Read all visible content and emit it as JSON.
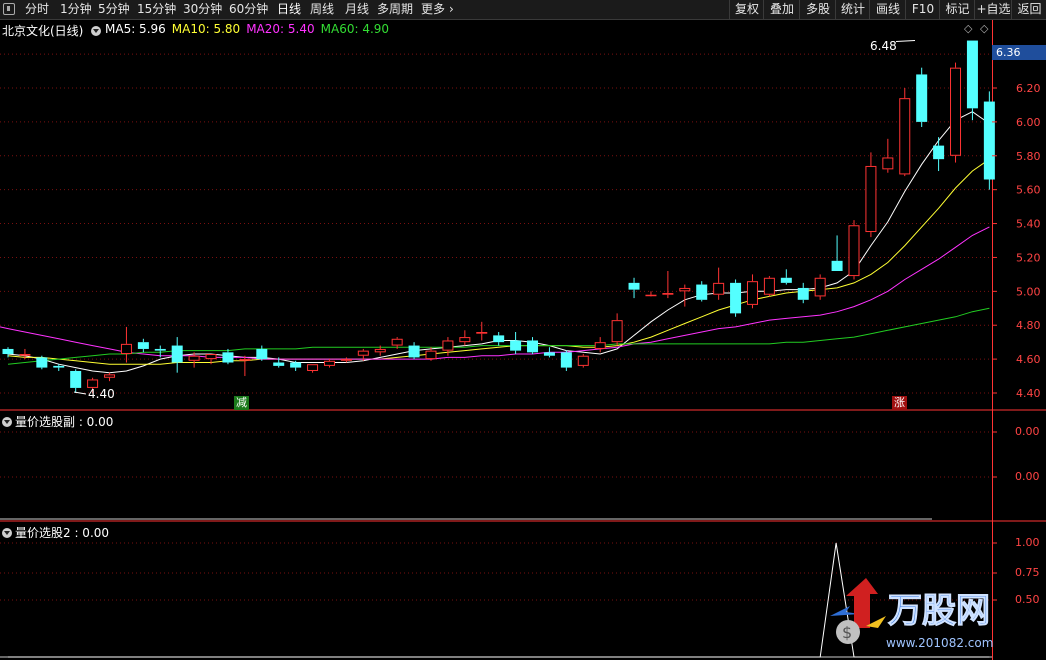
{
  "toolbar": {
    "periods": [
      "分时",
      "1分钟",
      "5分钟",
      "15分钟",
      "30分钟",
      "60分钟",
      "日线",
      "周线",
      "月线",
      "多周期",
      "更多"
    ],
    "active_period": "日线",
    "right_buttons": [
      "复权",
      "叠加",
      "多股",
      "统计",
      "画线",
      "F10",
      "标记",
      "+自选",
      "返回"
    ]
  },
  "main_panel": {
    "title": "北京文化(日线)",
    "ma_labels": [
      {
        "text": "MA5: 5.96",
        "color": "#ffffff"
      },
      {
        "text": "MA10: 5.80",
        "color": "#ffff33"
      },
      {
        "text": "MA20: 5.40",
        "color": "#ff33ff"
      },
      {
        "text": "MA60: 4.90",
        "color": "#33dd33"
      }
    ],
    "current_price": "6.36",
    "high_label": "6.48",
    "low_label": "4.40",
    "signal_reduce": "减",
    "signal_rise": "涨",
    "y_ticks": [
      {
        "label": "6.20",
        "value": 6.2
      },
      {
        "label": "6.00",
        "value": 6.0
      },
      {
        "label": "5.80",
        "value": 5.8
      },
      {
        "label": "5.60",
        "value": 5.6
      },
      {
        "label": "5.40",
        "value": 5.4
      },
      {
        "label": "5.20",
        "value": 5.2
      },
      {
        "label": "5.00",
        "value": 5.0
      },
      {
        "label": "4.80",
        "value": 4.8
      },
      {
        "label": "4.60",
        "value": 4.6
      },
      {
        "label": "4.40",
        "value": 4.4
      }
    ]
  },
  "sub_panel_1": {
    "title": "量价选股副 : 0.00",
    "y_ticks": [
      "0.00",
      "0.00"
    ]
  },
  "sub_panel_2": {
    "title": "量价选股2 : 0.00",
    "y_ticks": [
      "1.00",
      "0.75",
      "0.50"
    ]
  },
  "watermark": {
    "brand": "万股网",
    "site": "www.201082.com"
  },
  "colors": {
    "up": "#ff3333",
    "down": "#54ffff",
    "grid": "#7a1010",
    "axis": "#ff3333"
  },
  "chart_data": {
    "type": "candlestick",
    "candles": [
      [
        4.66,
        4.67,
        4.61,
        4.63
      ],
      [
        4.62,
        4.66,
        4.6,
        4.63
      ],
      [
        4.61,
        4.62,
        4.54,
        4.55
      ],
      [
        4.56,
        4.57,
        4.53,
        4.55
      ],
      [
        4.53,
        4.54,
        4.4,
        4.43
      ],
      [
        4.43,
        4.49,
        4.4,
        4.48
      ],
      [
        4.49,
        4.52,
        4.47,
        4.51
      ],
      [
        4.63,
        4.79,
        4.58,
        4.69
      ],
      [
        4.7,
        4.72,
        4.64,
        4.66
      ],
      [
        4.66,
        4.68,
        4.61,
        4.65
      ],
      [
        4.68,
        4.73,
        4.52,
        4.58
      ],
      [
        4.59,
        4.64,
        4.55,
        4.62
      ],
      [
        4.6,
        4.63,
        4.57,
        4.63
      ],
      [
        4.64,
        4.66,
        4.57,
        4.58
      ],
      [
        4.59,
        4.62,
        4.5,
        4.6
      ],
      [
        4.66,
        4.68,
        4.59,
        4.6
      ],
      [
        4.58,
        4.61,
        4.55,
        4.56
      ],
      [
        4.58,
        4.59,
        4.53,
        4.55
      ],
      [
        4.53,
        4.57,
        4.52,
        4.57
      ],
      [
        4.56,
        4.6,
        4.55,
        4.59
      ],
      [
        4.59,
        4.61,
        4.58,
        4.6
      ],
      [
        4.62,
        4.66,
        4.59,
        4.65
      ],
      [
        4.64,
        4.68,
        4.62,
        4.66
      ],
      [
        4.68,
        4.73,
        4.66,
        4.72
      ],
      [
        4.68,
        4.7,
        4.6,
        4.61
      ],
      [
        4.6,
        4.67,
        4.59,
        4.65
      ],
      [
        4.65,
        4.73,
        4.62,
        4.71
      ],
      [
        4.7,
        4.77,
        4.68,
        4.73
      ],
      [
        4.75,
        4.82,
        4.71,
        4.76
      ],
      [
        4.74,
        4.76,
        4.68,
        4.7
      ],
      [
        4.71,
        4.76,
        4.63,
        4.65
      ],
      [
        4.71,
        4.73,
        4.63,
        4.64
      ],
      [
        4.64,
        4.67,
        4.61,
        4.62
      ],
      [
        4.64,
        4.65,
        4.53,
        4.55
      ],
      [
        4.56,
        4.63,
        4.55,
        4.62
      ],
      [
        4.66,
        4.73,
        4.64,
        4.7
      ],
      [
        4.7,
        4.87,
        4.68,
        4.83
      ],
      [
        5.05,
        5.08,
        4.96,
        5.01
      ],
      [
        4.98,
        5.0,
        4.97,
        4.98
      ],
      [
        4.98,
        5.12,
        4.96,
        4.99
      ],
      [
        5.0,
        5.04,
        4.91,
        5.02
      ],
      [
        5.04,
        5.06,
        4.94,
        4.95
      ],
      [
        4.98,
        5.14,
        4.95,
        5.05
      ],
      [
        5.05,
        5.07,
        4.85,
        4.87
      ],
      [
        4.92,
        5.1,
        4.9,
        5.06
      ],
      [
        4.98,
        5.09,
        4.97,
        5.08
      ],
      [
        5.08,
        5.13,
        5.04,
        5.05
      ],
      [
        5.02,
        5.05,
        4.93,
        4.95
      ],
      [
        4.97,
        5.1,
        4.95,
        5.08
      ],
      [
        5.18,
        5.33,
        5.14,
        5.12
      ],
      [
        5.09,
        5.42,
        5.07,
        5.39
      ],
      [
        5.35,
        5.82,
        5.32,
        5.74
      ],
      [
        5.72,
        5.9,
        5.7,
        5.79
      ],
      [
        5.69,
        6.2,
        5.68,
        6.14
      ],
      [
        6.28,
        6.32,
        5.97,
        6.0
      ],
      [
        5.86,
        5.91,
        5.71,
        5.78
      ],
      [
        5.8,
        6.35,
        5.76,
        6.32
      ],
      [
        6.48,
        6.48,
        6.01,
        6.08
      ],
      [
        6.12,
        6.18,
        5.6,
        5.66
      ]
    ],
    "ma_series": [
      {
        "name": "MA5",
        "values": [
          4.63,
          4.62,
          4.6,
          4.57,
          4.55,
          4.53,
          4.52,
          4.53,
          4.56,
          4.6,
          4.62,
          4.63,
          4.63,
          4.62,
          4.61,
          4.61,
          4.6,
          4.58,
          4.58,
          4.58,
          4.58,
          4.59,
          4.61,
          4.63,
          4.65,
          4.66,
          4.67,
          4.68,
          4.69,
          4.71,
          4.71,
          4.7,
          4.68,
          4.65,
          4.64,
          4.63,
          4.66,
          4.74,
          4.82,
          4.89,
          4.95,
          4.98,
          4.99,
          4.99,
          5.0,
          5.0,
          5.01,
          5.01,
          5.02,
          5.05,
          5.12,
          5.27,
          5.41,
          5.59,
          5.75,
          5.89,
          6.01,
          6.06,
          5.99
        ]
      },
      {
        "name": "MA10",
        "values": [
          4.62,
          4.61,
          4.61,
          4.6,
          4.59,
          4.58,
          4.57,
          4.57,
          4.57,
          4.57,
          4.58,
          4.58,
          4.58,
          4.59,
          4.59,
          4.6,
          4.6,
          4.6,
          4.6,
          4.6,
          4.6,
          4.6,
          4.6,
          4.61,
          4.62,
          4.63,
          4.64,
          4.65,
          4.66,
          4.67,
          4.68,
          4.68,
          4.68,
          4.68,
          4.67,
          4.67,
          4.68,
          4.7,
          4.73,
          4.77,
          4.81,
          4.85,
          4.89,
          4.92,
          4.95,
          4.97,
          4.99,
          5.0,
          5.01,
          5.02,
          5.05,
          5.1,
          5.17,
          5.27,
          5.38,
          5.49,
          5.61,
          5.71,
          5.78
        ]
      },
      {
        "name": "MA20",
        "values": [
          4.78,
          4.76,
          4.74,
          4.72,
          4.7,
          4.68,
          4.66,
          4.64,
          4.63,
          4.62,
          4.62,
          4.62,
          4.61,
          4.61,
          4.61,
          4.6,
          4.6,
          4.6,
          4.6,
          4.6,
          4.6,
          4.6,
          4.6,
          4.6,
          4.6,
          4.6,
          4.61,
          4.61,
          4.62,
          4.62,
          4.63,
          4.63,
          4.64,
          4.64,
          4.65,
          4.66,
          4.67,
          4.69,
          4.7,
          4.72,
          4.74,
          4.76,
          4.78,
          4.79,
          4.81,
          4.83,
          4.84,
          4.85,
          4.86,
          4.88,
          4.91,
          4.95,
          5.0,
          5.07,
          5.13,
          5.19,
          5.26,
          5.33,
          5.38
        ]
      },
      {
        "name": "MA60",
        "values": [
          4.57,
          4.58,
          4.59,
          4.6,
          4.61,
          4.62,
          4.63,
          4.63,
          4.64,
          4.64,
          4.65,
          4.65,
          4.65,
          4.65,
          4.66,
          4.66,
          4.66,
          4.66,
          4.67,
          4.67,
          4.67,
          4.67,
          4.67,
          4.67,
          4.67,
          4.67,
          4.67,
          4.67,
          4.68,
          4.68,
          4.68,
          4.68,
          4.68,
          4.68,
          4.68,
          4.68,
          4.69,
          4.69,
          4.69,
          4.69,
          4.69,
          4.69,
          4.69,
          4.69,
          4.69,
          4.69,
          4.7,
          4.7,
          4.71,
          4.72,
          4.73,
          4.75,
          4.77,
          4.79,
          4.81,
          4.83,
          4.85,
          4.88,
          4.9
        ]
      }
    ],
    "ylim": [
      4.35,
      6.55
    ],
    "sub2_values": [
      0,
      0,
      0,
      0,
      0,
      0,
      0,
      0,
      0,
      0,
      0,
      0,
      0,
      0,
      0,
      0,
      0,
      0,
      0,
      0,
      0,
      0,
      0,
      0,
      0,
      0,
      0,
      0,
      0,
      0,
      0,
      0,
      0,
      0,
      0,
      0,
      0,
      0,
      0,
      0,
      0,
      0,
      0,
      0,
      0,
      0,
      0,
      0,
      0,
      1,
      0,
      0,
      0,
      0,
      0,
      0,
      0,
      0,
      0
    ]
  }
}
